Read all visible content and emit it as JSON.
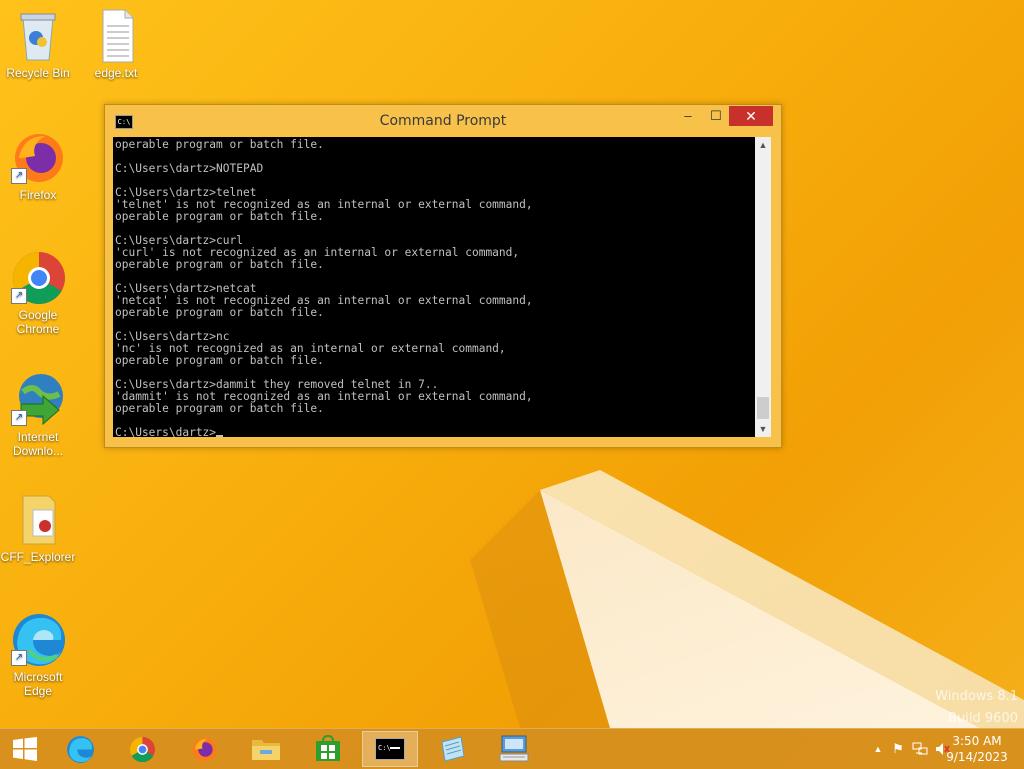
{
  "desktop": {
    "icons": [
      {
        "label": "Recycle Bin"
      },
      {
        "label": "edge.txt"
      },
      {
        "label": "Firefox"
      },
      {
        "label": "Google Chrome"
      },
      {
        "label": "Internet Downlo..."
      },
      {
        "label": "CFF_Explorer"
      },
      {
        "label": "Microsoft Edge"
      }
    ],
    "watermark": {
      "line1": "Windows 8.1",
      "line2": "Build 9600"
    }
  },
  "cmd_window": {
    "title": "Command Prompt",
    "icon_text": "C:\\",
    "controls": {
      "minimize": "–",
      "maximize": "☐",
      "close": "✕"
    },
    "lines": [
      "operable program or batch file.",
      "",
      "C:\\Users\\dartz>NOTEPAD",
      "",
      "C:\\Users\\dartz>telnet",
      "'telnet' is not recognized as an internal or external command,",
      "operable program or batch file.",
      "",
      "C:\\Users\\dartz>curl",
      "'curl' is not recognized as an internal or external command,",
      "operable program or batch file.",
      "",
      "C:\\Users\\dartz>netcat",
      "'netcat' is not recognized as an internal or external command,",
      "operable program or batch file.",
      "",
      "C:\\Users\\dartz>nc",
      "'nc' is not recognized as an internal or external command,",
      "operable program or batch file.",
      "",
      "C:\\Users\\dartz>dammit they removed telnet in 7..",
      "'dammit' is not recognized as an internal or external command,",
      "operable program or batch file.",
      ""
    ],
    "prompt": "C:\\Users\\dartz>"
  },
  "taskbar": {
    "items": [
      {
        "icon": "start-icon"
      },
      {
        "icon": "edge-icon"
      },
      {
        "icon": "chrome-icon"
      },
      {
        "icon": "firefox-icon"
      },
      {
        "icon": "file-explorer-icon"
      },
      {
        "icon": "store-icon"
      },
      {
        "icon": "cmd-icon",
        "active": true
      },
      {
        "icon": "notepad-icon"
      },
      {
        "icon": "remote-desktop-icon"
      }
    ],
    "clock": {
      "time": "3:50 AM",
      "date": "9/14/2023"
    }
  },
  "colors": {
    "accent": "#f7c14a",
    "close_button": "#c7302b",
    "console_bg": "#000000",
    "console_fg": "#c0c0c0"
  }
}
